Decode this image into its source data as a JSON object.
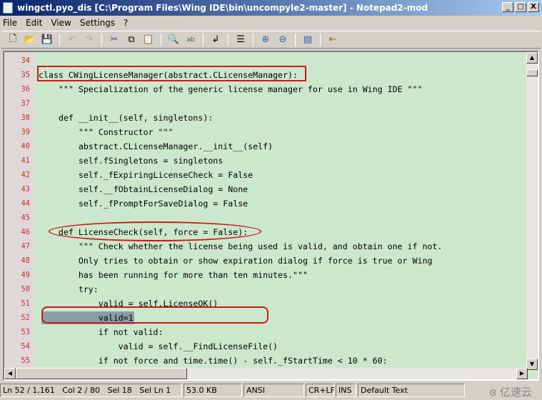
{
  "window": {
    "title": "wingctl.pyo_dis [C:\\Program Files\\Wing IDE\\bin\\uncompyle2-master] - Notepad2-mod",
    "min": "_",
    "max": "□",
    "close": "X"
  },
  "menu": [
    "File",
    "Edit",
    "View",
    "Settings",
    "?"
  ],
  "toolbar": {
    "icons": [
      "new-file-icon",
      "open-folder-icon",
      "save-icon",
      "undo-icon",
      "redo-icon",
      "cut-icon",
      "copy-icon",
      "paste-icon",
      "find-icon",
      "replace-icon",
      "word-wrap-icon",
      "line-numbers-icon",
      "zoom-in-icon",
      "zoom-out-icon",
      "view-icon",
      "exit-icon"
    ]
  },
  "editor": {
    "lines": [
      {
        "n": "34",
        "t": ""
      },
      {
        "n": "35",
        "t": "class CWingLicenseManager(abstract.CLicenseManager):"
      },
      {
        "n": "36",
        "t": "    \"\"\" Specialization of the generic license manager for use in Wing IDE \"\"\""
      },
      {
        "n": "37",
        "t": ""
      },
      {
        "n": "38",
        "t": "    def __init__(self, singletons):"
      },
      {
        "n": "39",
        "t": "        \"\"\" Constructor \"\"\""
      },
      {
        "n": "40",
        "t": "        abstract.CLicenseManager.__init__(self)"
      },
      {
        "n": "41",
        "t": "        self.fSingletons = singletons"
      },
      {
        "n": "42",
        "t": "        self._fExpiringLicenseCheck = False"
      },
      {
        "n": "43",
        "t": "        self.__fObtainLicenseDialog = None"
      },
      {
        "n": "44",
        "t": "        self._fPromptForSaveDialog = False"
      },
      {
        "n": "45",
        "t": ""
      },
      {
        "n": "46",
        "t": "    def LicenseCheck(self, force = False):"
      },
      {
        "n": "47",
        "t": "        \"\"\" Check whether the license being used is valid, and obtain one if not."
      },
      {
        "n": "48",
        "t": "        Only tries to obtain or show expiration dialog if force is true or Wing"
      },
      {
        "n": "49",
        "t": "        has been running for more than ten minutes.\"\"\""
      },
      {
        "n": "50",
        "t": "        try:"
      },
      {
        "n": "51",
        "t": "            valid = self.LicenseOK()"
      },
      {
        "n": "52",
        "t": "            valid=1"
      },
      {
        "n": "53",
        "t": "            if not valid:"
      },
      {
        "n": "54",
        "t": "                valid = self.__FindLicenseFile()"
      },
      {
        "n": "55",
        "t": "            if not force and time.time() - self._fStartTime < 10 * 60:"
      }
    ],
    "selected_line": "52",
    "colors": {
      "background": "#cce8cc",
      "line_numbers": "#c83030",
      "selection": "#8a9ea8",
      "annotation": "#d01818"
    }
  },
  "status": {
    "line": "Ln 52 / 1,161",
    "col": "Col 2 / 80",
    "sel": "Sel 18",
    "selln": "Sel Ln 1",
    "size": "53.0 KB",
    "encoding": "ANSI",
    "eol": "CR+LF",
    "mode": "INS",
    "scheme": "Default Text"
  },
  "watermark": "亿速云"
}
